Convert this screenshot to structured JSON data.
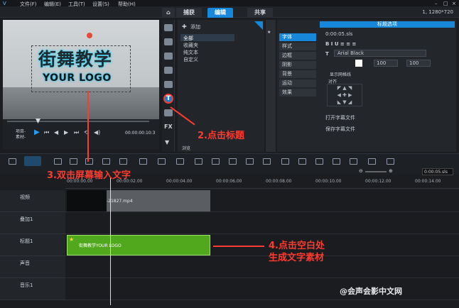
{
  "menu": {
    "file": "文件(F)",
    "edit": "编辑(E)",
    "tools": "工具(T)",
    "settings": "设置(S)",
    "help": "帮助(H)"
  },
  "tabs": {
    "capture": "捕获",
    "edit": "编辑",
    "share": "共享"
  },
  "resolution": "1, 1280*720",
  "preview": {
    "title_cn": "街舞教学",
    "title_en": "YOUR LOGO",
    "mode_label": "项目-",
    "clip_label": "素材-",
    "timecode": "00:00:00:10:3"
  },
  "library": {
    "add": "添加",
    "items": [
      "全部",
      "收藏夹",
      "纯文本",
      "自定义"
    ],
    "browse": "浏览"
  },
  "options": {
    "header": "标题选项",
    "time": "0:00:05.sls",
    "font": "Arial Black",
    "size": "100",
    "list": [
      "字体",
      "样式",
      "边框",
      "阴影",
      "背景",
      "运动",
      "效果"
    ],
    "grid": "显示网格线",
    "align": "对齐",
    "open": "打开字幕文件",
    "save": "保存字幕文件",
    "time2": "0:00:05.sls"
  },
  "ruler": [
    "00:00:00.00",
    "00:00:02.00",
    "00:00:04.00",
    "00:00:06.00",
    "00:00:08.00",
    "00:00:10.00",
    "00:00:12.00",
    "00:00:14.00"
  ],
  "tracks": {
    "video": "视频",
    "overlay": "叠加1",
    "title": "标题1",
    "voice": "声音",
    "music": "音乐1"
  },
  "clips": {
    "video": "-21827.mp4",
    "title": "街舞教学YOUR LOGO"
  },
  "annotations": {
    "a2": "2.点击标题",
    "a3": "3.双击屏幕输入文字",
    "a4_1": "4.点击空白处",
    "a4_2": "生成文字素材"
  },
  "watermark": "@会声会影中文网"
}
